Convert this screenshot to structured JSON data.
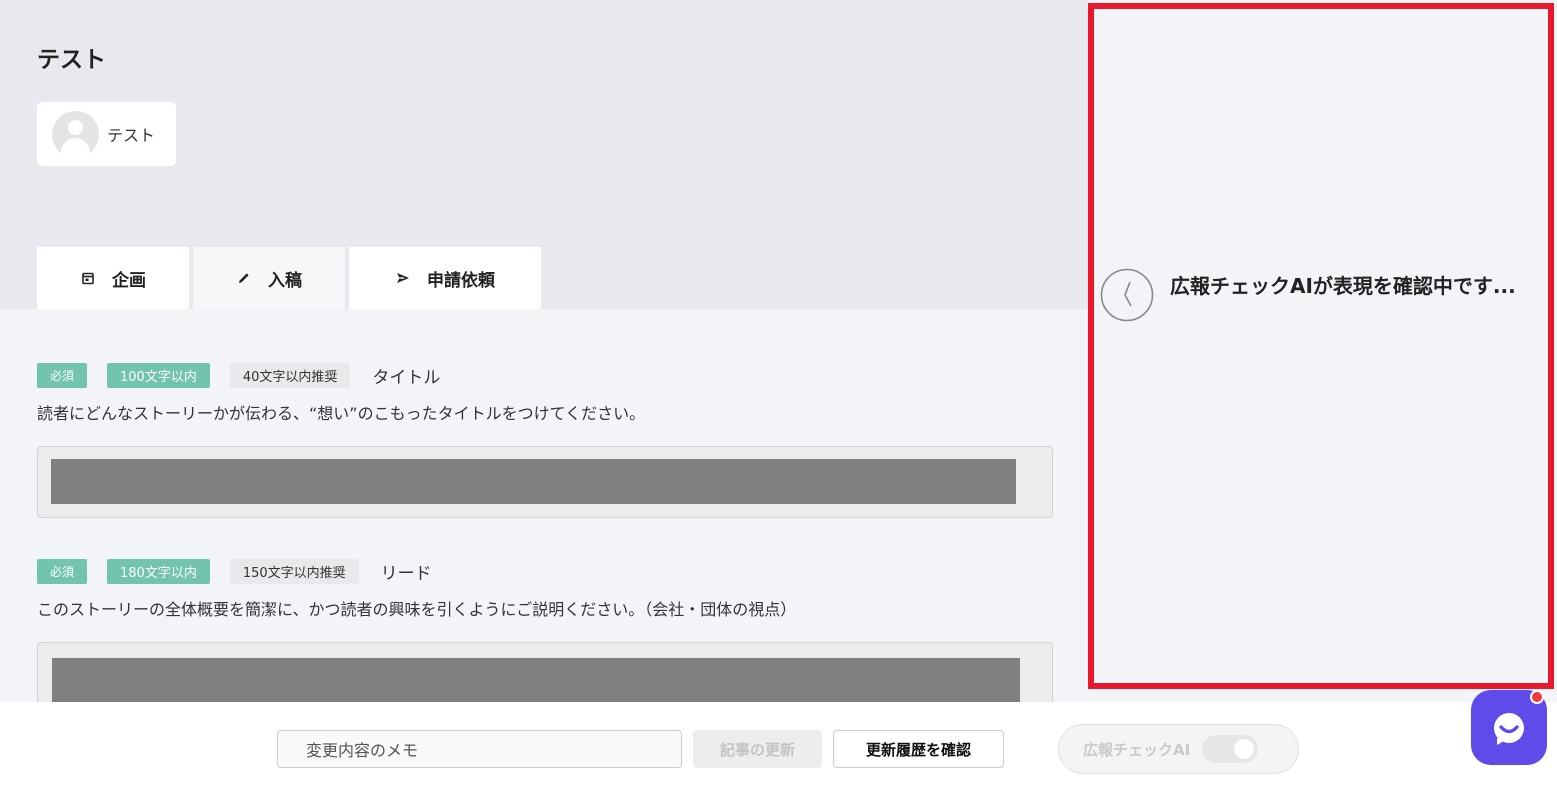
{
  "page": {
    "title": "テスト"
  },
  "author": {
    "name": "テスト",
    "icon": "user-avatar-icon"
  },
  "tabs": [
    {
      "label": "企画",
      "icon": "calendar-icon",
      "active": true
    },
    {
      "label": "入稿",
      "icon": "pencil-icon"
    },
    {
      "label": "申請依頼",
      "icon": "send-icon"
    }
  ],
  "fields": [
    {
      "badges": {
        "required": "必須",
        "max": "100文字以内",
        "recommended": "40文字以内推奨"
      },
      "label": "タイトル",
      "help": "読者にどんなストーリーかが伝わる、“想い”のこもったタイトルをつけてください。"
    },
    {
      "badges": {
        "required": "必須",
        "max": "180文字以内",
        "recommended": "150文字以内推奨"
      },
      "label": "リード",
      "help": "このストーリーの全体概要を簡潔に、かつ読者の興味を引くようにご説明ください。（会社・団体の視点）"
    }
  ],
  "bottom_bar": {
    "memo_placeholder": "変更内容のメモ",
    "update_label": "記事の更新",
    "history_label": "更新履歴を確認",
    "ai_toggle_label": "広報チェックAI"
  },
  "ai_panel": {
    "status": "広報チェックAIが表現を確認中です...",
    "icon": "clock-icon"
  },
  "colors": {
    "badge_green": "#72c4af",
    "panel_border": "#e8192c",
    "chat_button": "#5f4bea",
    "notification": "#ef3b3b"
  }
}
